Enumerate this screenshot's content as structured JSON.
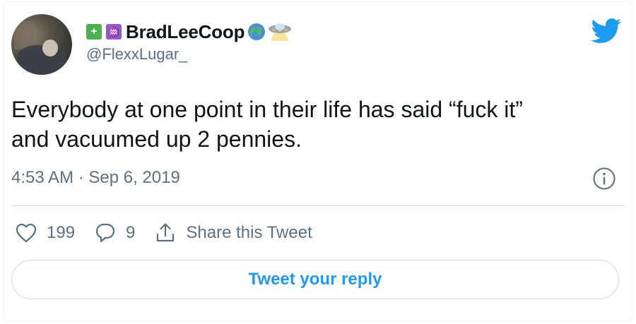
{
  "user": {
    "display_name": "BradLeeCoop",
    "handle": "@FlexxLugar_",
    "emojis": [
      "battery-icon",
      "aquarius-icon",
      "globe-icon",
      "ufo-icon"
    ]
  },
  "tweet": {
    "text_line1": "Everybody at one point in their life has said “fuck it”",
    "text_line2": "and vacuumed up 2 pennies.",
    "timestamp": "4:53 AM · Sep 6, 2019"
  },
  "actions": {
    "likes": "199",
    "replies": "9",
    "share_label": "Share this Tweet"
  },
  "reply_button": "Tweet your reply",
  "colors": {
    "accent": "#1d9bf0",
    "muted": "#5b7083",
    "text": "#0f1419",
    "divider": "#cfd9de"
  }
}
